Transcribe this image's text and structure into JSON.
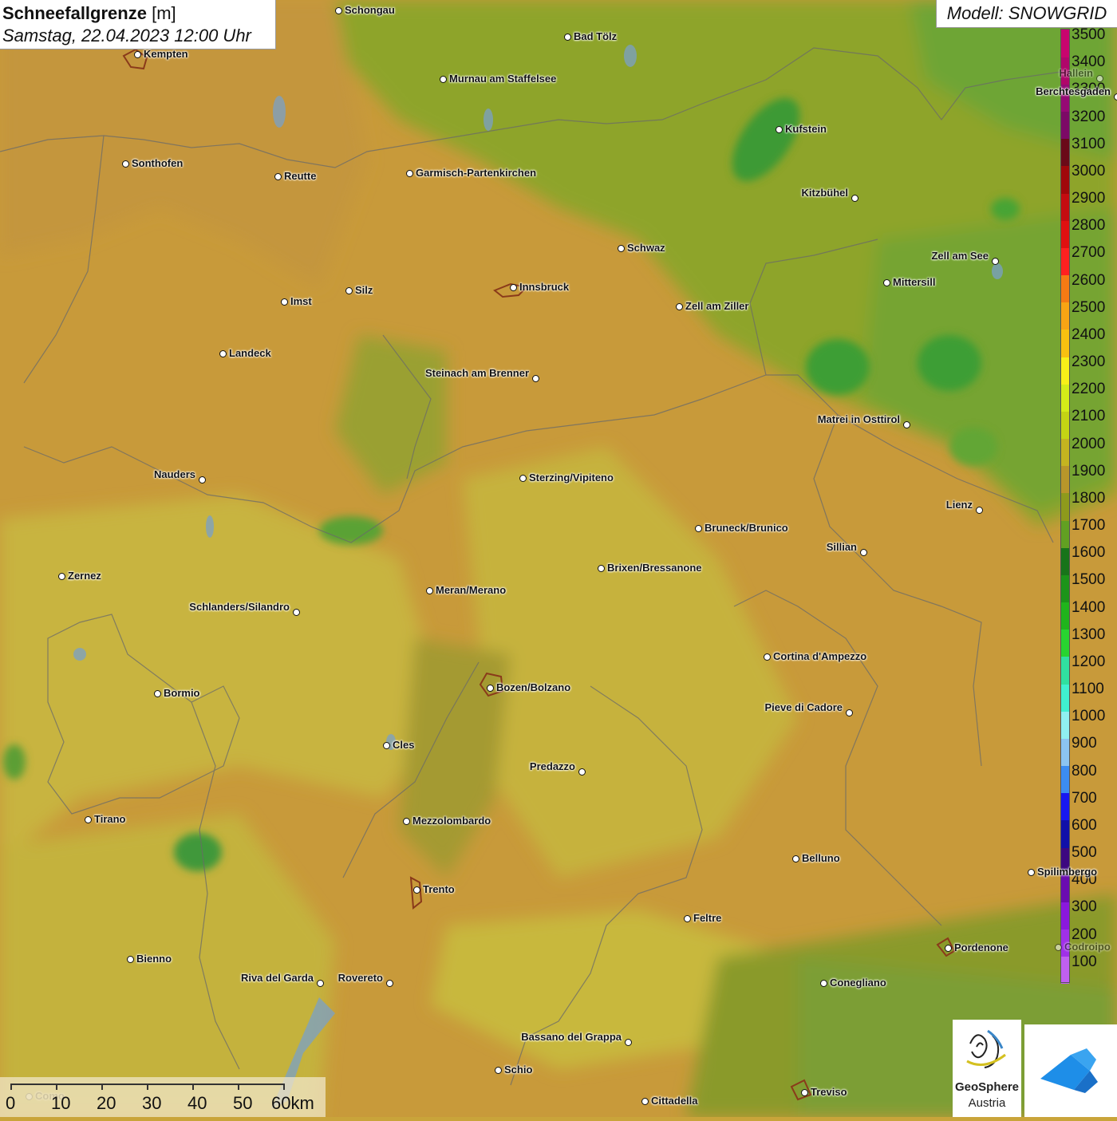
{
  "title": {
    "main": "Schneefallgrenze",
    "unit": "[m]",
    "datetime": "Samstag, 22.04.2023 12:00 Uhr"
  },
  "model_label": "Modell: SNOWGRID",
  "legend": {
    "values": [
      "3500",
      "3400",
      "3300",
      "3200",
      "3100",
      "3000",
      "2900",
      "2800",
      "2700",
      "2600",
      "2500",
      "2400",
      "2300",
      "2200",
      "2100",
      "2000",
      "1900",
      "1800",
      "1700",
      "1600",
      "1500",
      "1400",
      "1300",
      "1200",
      "1100",
      "1000",
      "900",
      "800",
      "700",
      "600",
      "500",
      "400",
      "300",
      "200",
      "100"
    ],
    "colors": [
      "#c8046e",
      "#b0066a",
      "#960a74",
      "#7c0a66",
      "#6a0a18",
      "#a0080a",
      "#c40c10",
      "#e01010",
      "#ff2020",
      "#f47a14",
      "#f8a414",
      "#f8c010",
      "#f8f018",
      "#d4ec18",
      "#c4d414",
      "#c4b420",
      "#b8962a",
      "#8e9a1c",
      "#62a022",
      "#18741a",
      "#1c941a",
      "#20b41c",
      "#28d430",
      "#30e0a0",
      "#40f0d0",
      "#90f0f0",
      "#8cc4f0",
      "#3c8cf0",
      "#1818f0",
      "#1010a8",
      "#3c0880",
      "#6a0cb0",
      "#8a18dc",
      "#a030e8",
      "#c060f0"
    ]
  },
  "places": [
    {
      "name": "Schongau"
    },
    {
      "name": "Bad Tölz"
    },
    {
      "name": "Kempten"
    },
    {
      "name": "Murnau am Staffelsee"
    },
    {
      "name": "Berchtesgaden"
    },
    {
      "name": "Kufstein"
    },
    {
      "name": "Sonthofen"
    },
    {
      "name": "Reutte"
    },
    {
      "name": "Garmisch-Partenkirchen"
    },
    {
      "name": "Kitzbühel"
    },
    {
      "name": "Schwaz"
    },
    {
      "name": "Zell am See"
    },
    {
      "name": "Mittersill"
    },
    {
      "name": "Innsbruck"
    },
    {
      "name": "Silz"
    },
    {
      "name": "Imst"
    },
    {
      "name": "Zell am Ziller"
    },
    {
      "name": "Landeck"
    },
    {
      "name": "Steinach am Brenner"
    },
    {
      "name": "Matrei in Osttirol"
    },
    {
      "name": "Nauders"
    },
    {
      "name": "Sterzing/Vipiteno"
    },
    {
      "name": "Lienz"
    },
    {
      "name": "Bruneck/Brunico"
    },
    {
      "name": "Sillian"
    },
    {
      "name": "Zernez"
    },
    {
      "name": "Brixen/Bressanone"
    },
    {
      "name": "Meran/Merano"
    },
    {
      "name": "Schlanders/Silandro"
    },
    {
      "name": "Cortina d'Ampezzo"
    },
    {
      "name": "Bormio"
    },
    {
      "name": "Bozen/Bolzano"
    },
    {
      "name": "Pieve di Cadore"
    },
    {
      "name": "Cles"
    },
    {
      "name": "Predazzo"
    },
    {
      "name": "Tirano"
    },
    {
      "name": "Mezzolombardo"
    },
    {
      "name": "Belluno"
    },
    {
      "name": "Spilimbergo"
    },
    {
      "name": "Trento"
    },
    {
      "name": "Feltre"
    },
    {
      "name": "Pordenone"
    },
    {
      "name": "Bienno"
    },
    {
      "name": "Riva del Garda"
    },
    {
      "name": "Rovereto"
    },
    {
      "name": "Conegliano"
    },
    {
      "name": "Bassano del Grappa"
    },
    {
      "name": "Schio"
    },
    {
      "name": "Treviso"
    },
    {
      "name": "Cittadella"
    },
    {
      "name": "Hallein"
    },
    {
      "name": "Codroipo"
    },
    {
      "name": "Como"
    }
  ],
  "scale_bar": {
    "labels": [
      "0",
      "10",
      "20",
      "30",
      "40",
      "50",
      "60km"
    ]
  },
  "logos": {
    "geosphere_line1": "GeoSphere",
    "geosphere_line2": "Austria",
    "icon": "cloud-snow-logo-icon"
  }
}
